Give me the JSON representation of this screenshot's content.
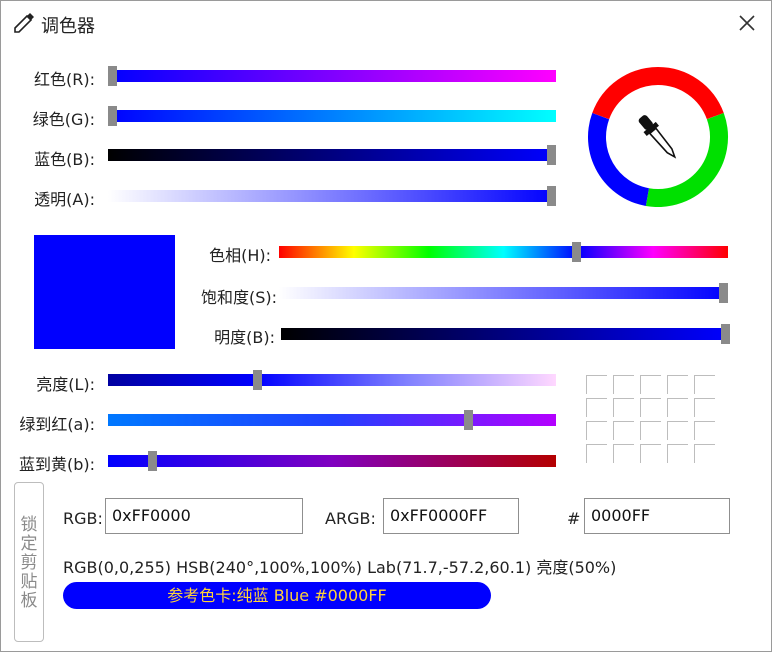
{
  "window": {
    "title": "调色器",
    "title_icon": "eyedropper-icon",
    "close_icon": "close-icon"
  },
  "current_color": "#0000FF",
  "channels": {
    "red": {
      "label": "红色(R):",
      "value": 0,
      "max": 255,
      "gradient": [
        "#0000FF",
        "#FF00FF"
      ]
    },
    "green": {
      "label": "绿色(G):",
      "value": 0,
      "max": 255,
      "gradient": [
        "#0000FF",
        "#00FFFF"
      ]
    },
    "blue": {
      "label": "蓝色(B):",
      "value": 255,
      "max": 255,
      "gradient": [
        "#000000",
        "#0000FF"
      ]
    },
    "alpha": {
      "label": "透明(A):",
      "value": 255,
      "max": 255,
      "gradient": [
        "#FFFFFF",
        "#0000FF"
      ]
    }
  },
  "hsb": {
    "hue": {
      "label": "色相(H):",
      "value": 240,
      "max": 360
    },
    "saturation": {
      "label": "饱和度(S):",
      "value": 100,
      "max": 100,
      "gradient": [
        "#FFFFFF",
        "#0000FF"
      ]
    },
    "brightness": {
      "label": "明度(B):",
      "value": 100,
      "max": 100,
      "gradient": [
        "#000000",
        "#0000FF"
      ]
    }
  },
  "lab": {
    "lightness": {
      "label": "亮度(L):",
      "value": 0.33,
      "gradient": [
        "#0000A0",
        "#FFD8FF"
      ]
    },
    "a": {
      "label": "绿到红(a):",
      "value": 0.81,
      "gradient": [
        "#0078FF",
        "#B400FF"
      ]
    },
    "b": {
      "label": "蓝到黄(b):",
      "value": 0.09,
      "gradient": [
        "#0000FF",
        "#B40000"
      ]
    }
  },
  "lock_clipboard_button": {
    "chars": [
      "锁",
      "定",
      "剪",
      "贴",
      "板"
    ]
  },
  "fields": {
    "rgb": {
      "label": "RGB:",
      "value": "0xFF0000"
    },
    "argb": {
      "label": "ARGB:",
      "value": "0xFF0000FF"
    },
    "hex": {
      "label": "#",
      "value": "0000FF"
    }
  },
  "info_line": "RGB(0,0,255) HSB(240°,100%,100%) Lab(71.7,-57.2,60.1) 亮度(50%)",
  "reference_card": {
    "text": "参考色卡:纯蓝 Blue #0000FF",
    "text_color": "#FFD23A"
  },
  "wheel": {
    "segments": [
      "#FF0000",
      "#00E000",
      "#0000FF"
    ],
    "icon": "eyedropper-icon"
  }
}
